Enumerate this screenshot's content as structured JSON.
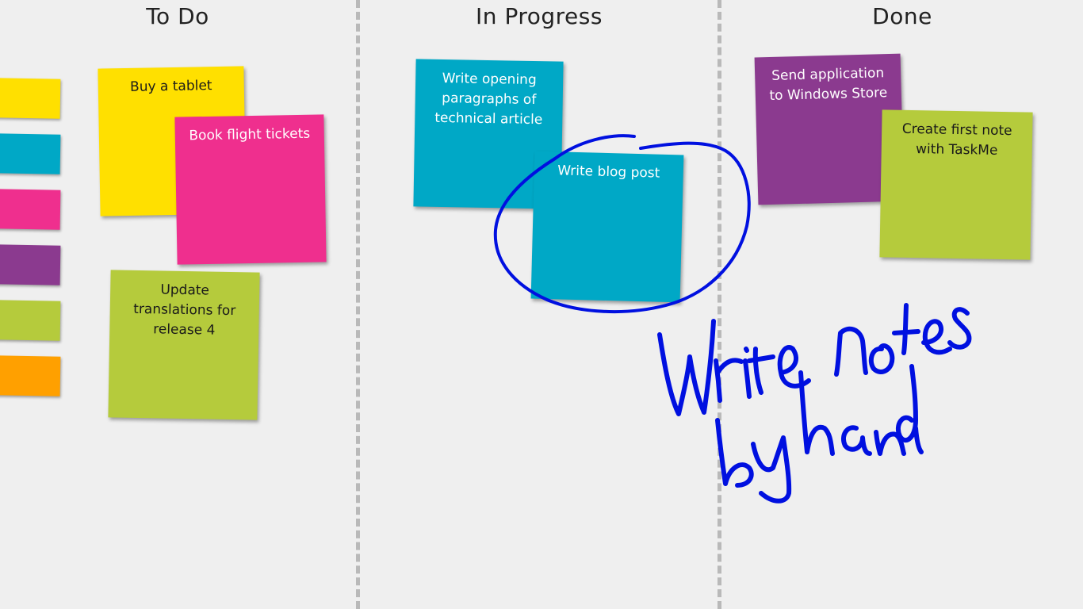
{
  "columns": [
    {
      "title": "To Do"
    },
    {
      "title": "In Progress"
    },
    {
      "title": "Done"
    }
  ],
  "palette": {
    "colors": [
      "#ffe000",
      "#00a8c6",
      "#ef2f8e",
      "#8b3a8f",
      "#b5cb3c",
      "#ffa000"
    ]
  },
  "notes": {
    "buy_tablet": {
      "text": "Buy a tablet",
      "color": "#ffe000"
    },
    "book_flight": {
      "text": "Book flight tickets",
      "color": "#ef2f8e"
    },
    "update_translations": {
      "text": "Update translations for release 4",
      "color": "#b5cb3c"
    },
    "write_opening": {
      "text": "Write opening paragraphs of technical article",
      "color": "#00a8c6"
    },
    "write_blog": {
      "text": "Write blog post",
      "color": "#00a8c6"
    },
    "send_application": {
      "text": "Send application to Windows Store",
      "color": "#8b3a8f"
    },
    "create_first_note": {
      "text": "Create first note with TaskMe",
      "color": "#b5cb3c"
    }
  },
  "ink": {
    "color": "#0010e0",
    "handwriting": "Write notes by hand"
  }
}
